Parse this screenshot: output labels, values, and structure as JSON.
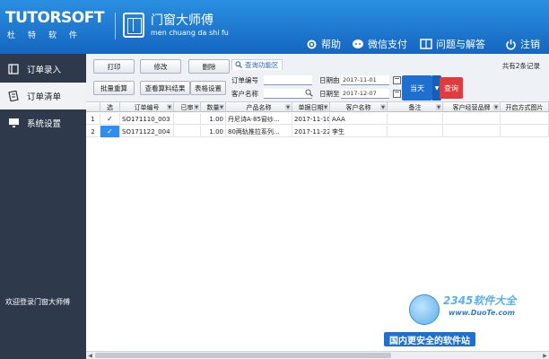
{
  "header": {
    "logo_text": "TUTORSOFT",
    "logo_chars": "杜特软件",
    "brand_title": "门窗大师傅",
    "brand_sub": "men chuang da shi fu",
    "links": [
      {
        "label": "帮助",
        "icon": "gear-icon"
      },
      {
        "label": "微信支付",
        "icon": "chat-bubble-icon"
      },
      {
        "label": "问题与解答",
        "icon": "book-icon"
      },
      {
        "label": "注销",
        "icon": "power-icon"
      }
    ]
  },
  "sidebar": {
    "items": [
      {
        "label": "订单录入",
        "icon": "panel-icon",
        "active": false
      },
      {
        "label": "订单清单",
        "icon": "list-icon",
        "active": true
      },
      {
        "label": "系统设置",
        "icon": "monitor-icon",
        "active": false
      }
    ],
    "welcome": "欢迎登录门窗大师傅"
  },
  "toolbar": {
    "print": "打印",
    "edit": "修改",
    "delete": "删除",
    "batch_reset": "批量重算",
    "view_materials": "查看算料结果",
    "table_settings": "表格设置",
    "query_tab": "查询功能区",
    "order_no_label": "订单编号",
    "order_no_value": "",
    "customer_label": "客户名称",
    "customer_value": "",
    "date_from_label": "日期由",
    "date_from_value": "2017-11-01",
    "date_to_label": "日期至",
    "date_to_value": "2017-12-07",
    "today_label": "当天",
    "query_label": "查询",
    "total": "共有2条记录"
  },
  "grid": {
    "columns": [
      "",
      "选",
      "订单编号",
      "已审",
      "数量",
      "产品名称",
      "单据日期",
      "客户名称",
      "备注",
      "客户经营品牌",
      "开启方式图片"
    ],
    "rows": [
      {
        "idx": "1",
        "checked": "✓",
        "order_no": "SO171110_003",
        "reviewed": "",
        "qty": "1.00",
        "product": "丹尼诗A·85窗纱...",
        "date": "2017-11-10",
        "customer": "AAA",
        "note": "",
        "brand": "",
        "open_img": ""
      },
      {
        "idx": "2",
        "checked": "✓",
        "order_no": "SO171122_004",
        "reviewed": "",
        "qty": "1.00",
        "product": "80两轨推拉系列...",
        "date": "2017-11-22",
        "customer": "李生",
        "note": "",
        "brand": "",
        "open_img": ""
      }
    ]
  },
  "watermark": {
    "title": "2345软件大全",
    "url": "www.DuoTe.com",
    "slogan": "国内更安全的软件站"
  },
  "colors": {
    "header_blue": "#1e78d2",
    "sidebar_dark": "#2e3a4c",
    "today_blue": "#1e6fd0",
    "query_red": "#e23b3b",
    "check_blue": "#2e8ff0"
  }
}
